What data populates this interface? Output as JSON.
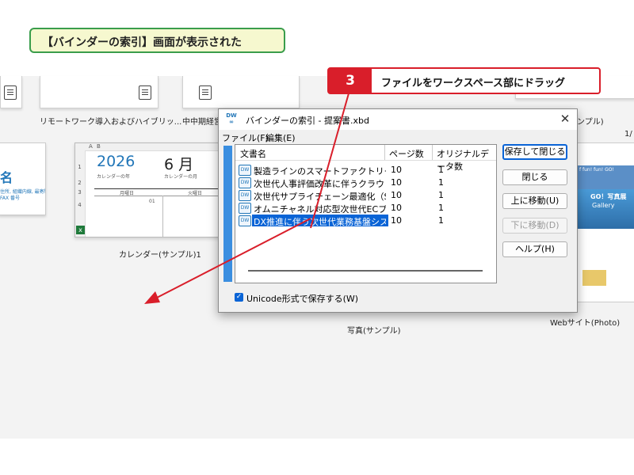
{
  "step_title": "【バインダーの索引】画面が表示された",
  "step_callout": {
    "number": "3",
    "text": "ファイルをワークスペース部にドラッグ"
  },
  "workspace": {
    "thumbnails": [
      {
        "caption": "リモートワーク導入およびハイブリッ..."
      },
      {
        "caption": "中中期経営"
      },
      {
        "caption": "ンプル)"
      },
      {
        "caption": "カレンダー(サンプル)1"
      },
      {
        "caption": "写真(サンプル)"
      },
      {
        "caption": "Webサイト(Photo)"
      }
    ],
    "calendar_thumb": {
      "col_a": "A",
      "col_b": "B",
      "rows": [
        "1",
        "2",
        "3",
        "4"
      ],
      "year": "2026",
      "year_label": "カレンダーの年",
      "month": "6 月",
      "month_label": "カレンダーの月",
      "weekday_mon": "月曜日",
      "weekday_tue": "火曜日",
      "day": "01"
    },
    "card_thumb": {
      "big": "名",
      "line1": "住所, 組織内線, 最寄駅",
      "line2": "FAX 番号"
    },
    "photo_thumb": {
      "line1": "f fun! fun! GO!",
      "line2": "GO！写真展",
      "line3": "Gallery"
    },
    "page_counter": "1/"
  },
  "dialog": {
    "app_icon": "DW",
    "title": "バインダーの索引 - 提案書.xbd",
    "close": "✕",
    "menu": [
      "ファイル(F)",
      "編集(E)"
    ],
    "columns": [
      "文書名",
      "ページ数",
      "オリジナルデータ数"
    ],
    "rows": [
      {
        "name": "製造ラインのスマートファクトリー化に伴う...",
        "pages": "10",
        "originals": "1",
        "selected": false
      },
      {
        "name": "次世代人事評価改革に伴うクラウド型...",
        "pages": "10",
        "originals": "1",
        "selected": false
      },
      {
        "name": "次世代サプライチェーン最適化（SCM...",
        "pages": "10",
        "originals": "1",
        "selected": false
      },
      {
        "name": "オムニチャネル対応型次世代ECプラット...",
        "pages": "10",
        "originals": "1",
        "selected": false
      },
      {
        "name": "DX推進に伴う次世代業務基盤システ...",
        "pages": "10",
        "originals": "1",
        "selected": true
      }
    ],
    "buttons": {
      "save_close": "保存して閉じる",
      "close": "閉じる",
      "move_up": "上に移動(U)",
      "move_down": "下に移動(D)",
      "help": "ヘルプ(H)"
    },
    "unicode_checkbox": {
      "label": "Unicode形式で保存する(W)",
      "checked": true
    }
  },
  "colors": {
    "accent": "#0a64d6",
    "callout_red": "#d91e2a",
    "title_green": "#3a9d4b",
    "side_bar": "#3a8ee0"
  }
}
